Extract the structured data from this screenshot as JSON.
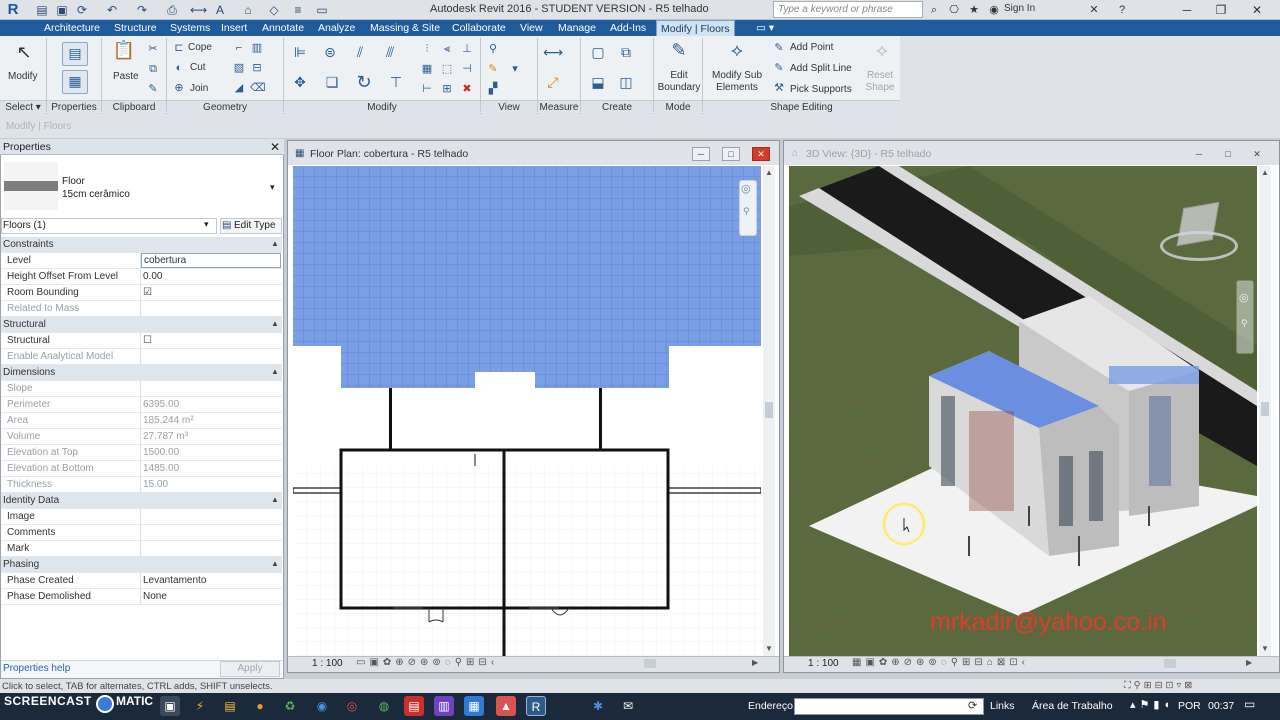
{
  "app": {
    "title": "Autodesk Revit 2016 -  STUDENT VERSION -   R5 telhado",
    "search_placeholder": "Type a keyword or phrase",
    "signin": "Sign In"
  },
  "tabs": [
    "Architecture",
    "Structure",
    "Systems",
    "Insert",
    "Annotate",
    "Analyze",
    "Massing & Site",
    "Collaborate",
    "View",
    "Manage",
    "Add-Ins",
    "Modify | Floors"
  ],
  "ribbon": {
    "select": {
      "modify": "Modify",
      "footer": "Select ▾"
    },
    "properties": {
      "footer": "Properties"
    },
    "clipboard": {
      "paste": "Paste",
      "footer": "Clipboard"
    },
    "geometry": {
      "cope": "Cope",
      "cut": "Cut",
      "join": "Join",
      "footer": "Geometry"
    },
    "modify_footer": "Modify",
    "view_footer": "View",
    "measure_footer": "Measure",
    "create_footer": "Create",
    "mode": {
      "edit_boundary": "Edit Boundary",
      "footer": "Mode"
    },
    "shape": {
      "modify_sub": "Modify Sub Elements",
      "add_point": "Add Point",
      "add_split_line": "Add Split Line",
      "pick_supports": "Pick Supports",
      "reset_shape": "Reset Shape",
      "footer": "Shape Editing"
    }
  },
  "context_label": "Modify | Floors",
  "properties": {
    "title": "Properties",
    "type_family": "Floor",
    "type_name": "15cm cerâmico",
    "filter": "Floors (1)",
    "edit_type": "Edit Type",
    "rows": [
      {
        "label": "Constraints",
        "cat": true
      },
      {
        "label": "Level",
        "value": "cobertura"
      },
      {
        "label": "Height Offset From Level",
        "value": "0.00"
      },
      {
        "label": "Room Bounding",
        "value": "☑"
      },
      {
        "label": "Related to Mass",
        "value": "",
        "dis": true
      },
      {
        "label": "Structural",
        "cat": true
      },
      {
        "label": "Structural",
        "value": "☐"
      },
      {
        "label": "Enable Analytical Model",
        "value": "",
        "dis": true
      },
      {
        "label": "Dimensions",
        "cat": true
      },
      {
        "label": "Slope",
        "value": "",
        "dis": true
      },
      {
        "label": "Perimeter",
        "value": "6395.00",
        "dis": true
      },
      {
        "label": "Area",
        "value": "185.244 m²",
        "dis": true
      },
      {
        "label": "Volume",
        "value": "27.787 m³",
        "dis": true
      },
      {
        "label": "Elevation at Top",
        "value": "1500.00",
        "dis": true
      },
      {
        "label": "Elevation at Bottom",
        "value": "1485.00",
        "dis": true
      },
      {
        "label": "Thickness",
        "value": "15.00",
        "dis": true
      },
      {
        "label": "Identity Data",
        "cat": true
      },
      {
        "label": "Image",
        "value": ""
      },
      {
        "label": "Comments",
        "value": ""
      },
      {
        "label": "Mark",
        "value": ""
      },
      {
        "label": "Phasing",
        "cat": true
      },
      {
        "label": "Phase Created",
        "value": "Levantamento"
      },
      {
        "label": "Phase Demolished",
        "value": "None"
      }
    ],
    "help": "Properties help",
    "apply": "Apply"
  },
  "view1": {
    "title": "Floor Plan: cobertura - R5 telhado",
    "scale": "1 : 100"
  },
  "view2": {
    "title": "3D View: {3D} - R5 telhado",
    "scale": "1 : 100",
    "watermark": "mrkadir@yahoo.co.in"
  },
  "status": {
    "hint": "Click to select, TAB for alternates, CTRL adds, SHIFT unselects."
  },
  "taskbar": {
    "screencast": "SCREENCAST",
    "matic": "MATIC",
    "address_label": "Endereço",
    "links": "Links",
    "desktop": "Área de Trabalho",
    "lang": "POR",
    "time": "00:37"
  },
  "colors": {
    "tabbar": "#1e5c9c",
    "roof_blue": "#7b9fe6",
    "watermark": "#e23a2b"
  }
}
